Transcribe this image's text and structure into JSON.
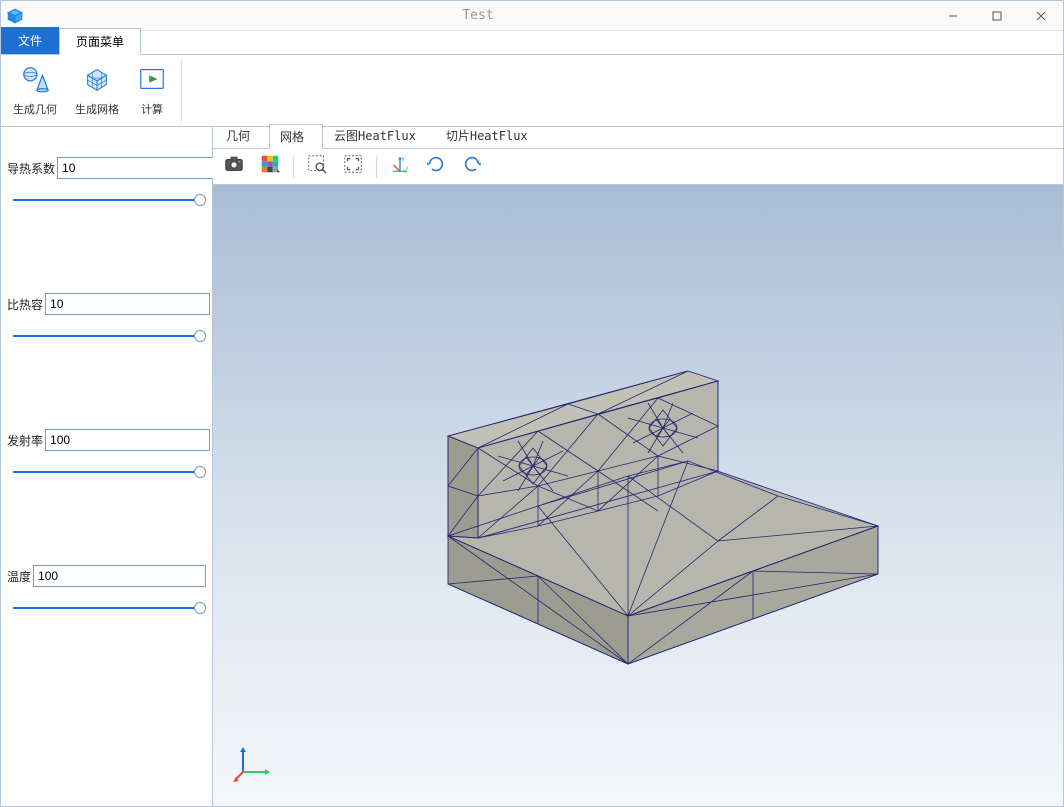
{
  "window": {
    "title": "Test"
  },
  "ribbon": {
    "file_tab": "文件",
    "page_tab": "页面菜单",
    "gen_geom": "生成几何",
    "gen_mesh": "生成网格",
    "compute": "计算"
  },
  "params": {
    "thermal_conductivity": {
      "label": "导热系数",
      "value": "10",
      "pct": 100
    },
    "specific_heat": {
      "label": "比热容",
      "value": "10",
      "pct": 100
    },
    "emissivity": {
      "label": "发射率",
      "value": "100",
      "pct": 100
    },
    "temperature": {
      "label": "温度",
      "value": "100",
      "pct": 100
    }
  },
  "viewer_tabs": {
    "geometry": "几何",
    "mesh": "网格",
    "cloud": "云图HeatFlux",
    "slice": "切片HeatFlux"
  },
  "colors": {
    "accent": "#1e6fd2",
    "border": "#b8c6d6"
  }
}
